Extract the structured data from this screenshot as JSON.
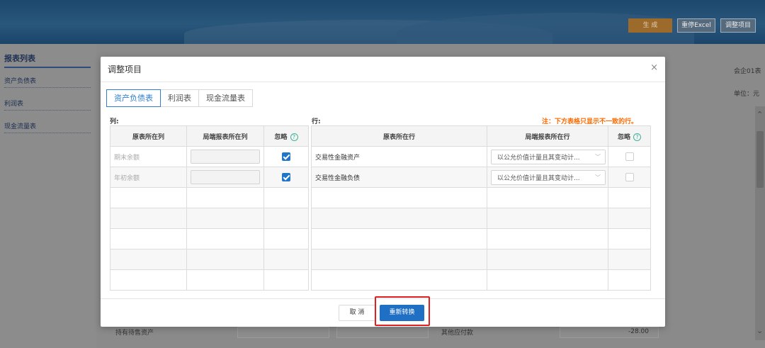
{
  "header": {
    "generate_label": "生 成",
    "export_excel_label": "重停Excel",
    "adjust_label": "调整项目"
  },
  "sidebar": {
    "title": "报表列表",
    "items": [
      {
        "label": "资产负债表"
      },
      {
        "label": "利润表"
      },
      {
        "label": "现金流量表"
      }
    ]
  },
  "background": {
    "form_code": "会企01表",
    "unit_label": "单位：元",
    "row_left_label": "持有待售资产",
    "row_right_label": "其他应付款",
    "row_right_value": "-28.00"
  },
  "modal": {
    "title": "调整项目",
    "close_glyph": "×",
    "tabs": [
      {
        "label": "资产负债表",
        "active": true
      },
      {
        "label": "利润表",
        "active": false
      },
      {
        "label": "现金流量表",
        "active": false
      }
    ],
    "columns_section": {
      "label": "列:",
      "headers": [
        "原表所在列",
        "局端报表所在列",
        "忽略"
      ],
      "rows": [
        {
          "source": "期末余额",
          "ignored": true
        },
        {
          "source": "年初余额",
          "ignored": true
        }
      ]
    },
    "rows_section": {
      "label": "行:",
      "note": "注：下方表格只显示不一致的行。",
      "headers": [
        "原表所在行",
        "局端报表所在行",
        "忽略"
      ],
      "rows": [
        {
          "source": "交易性金融资产",
          "target": "以公允价值计量且其变动计...",
          "ignored": false
        },
        {
          "source": "交易性金融负债",
          "target": "以公允价值计量且其变动计...",
          "ignored": false
        }
      ]
    },
    "help_glyph": "?",
    "cancel_label": "取 消",
    "reconvert_label": "重新转换"
  },
  "colors": {
    "primary": "#1f6fc5",
    "note": "#ff6a00",
    "highlight": "#e02020",
    "generate_btn": "#9c6a2b"
  }
}
